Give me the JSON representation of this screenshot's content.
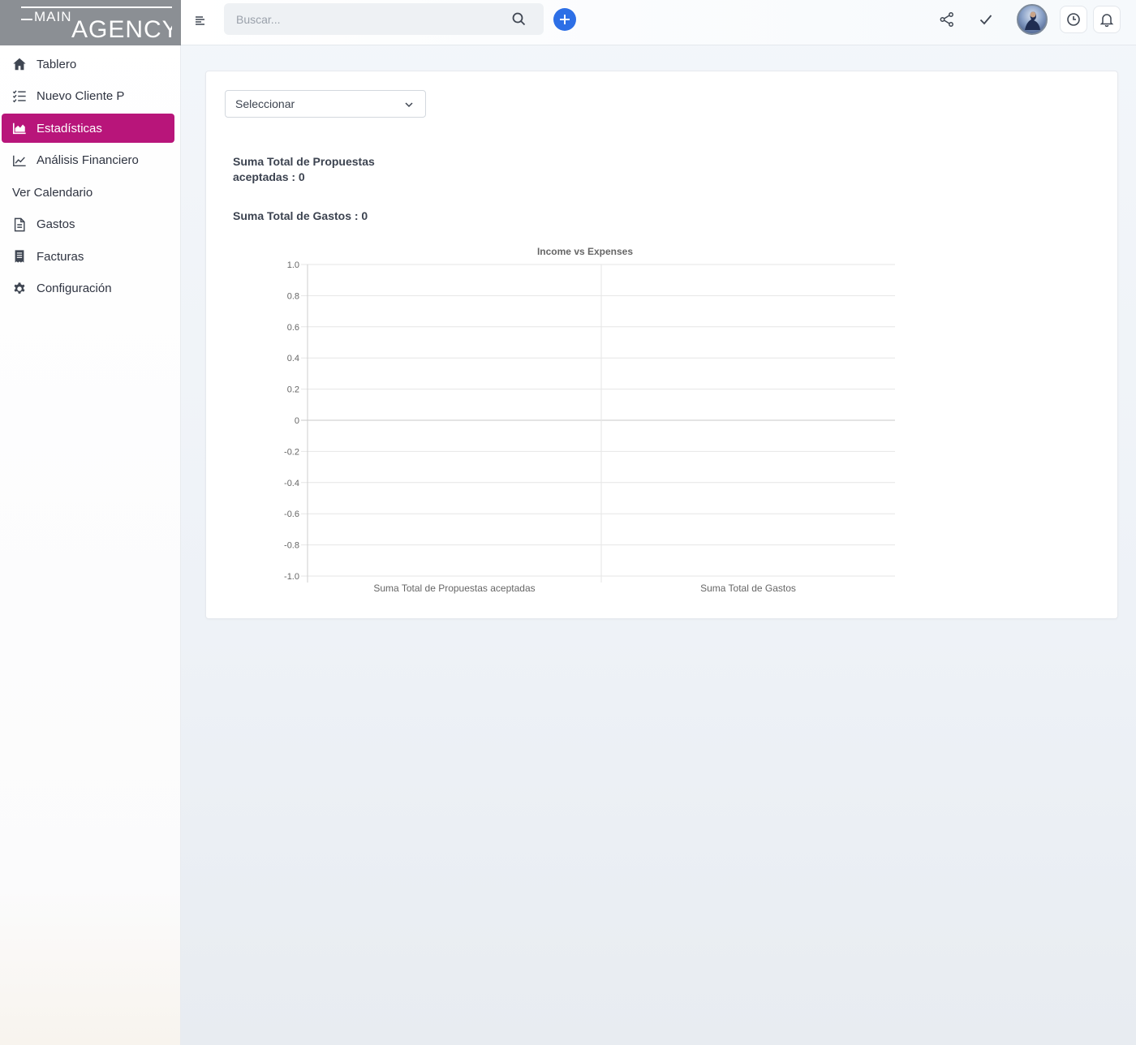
{
  "brand": {
    "logo_text": "MAIN AGENCY"
  },
  "sidebar": {
    "items": [
      {
        "label": "Tablero",
        "icon": "home-icon"
      },
      {
        "label": "Nuevo Cliente P",
        "icon": "checklist-icon"
      },
      {
        "label": "Estadísticas",
        "icon": "area-chart-icon",
        "active": true
      },
      {
        "label": "Análisis Financiero",
        "icon": "line-chart-icon"
      },
      {
        "label": "Ver Calendario"
      },
      {
        "label": "Gastos",
        "icon": "document-icon"
      },
      {
        "label": "Facturas",
        "icon": "receipt-icon"
      },
      {
        "label": "Configuración",
        "icon": "gear-icon"
      }
    ]
  },
  "header": {
    "search_placeholder": "Buscar...",
    "icons": [
      "menu-icon",
      "search-icon",
      "plus-icon",
      "share-icon",
      "check-icon",
      "avatar",
      "clock-icon",
      "bell-icon"
    ]
  },
  "main": {
    "select_label": "Seleccionar",
    "stat_proposals": "Suma Total de Propuestas aceptadas : 0",
    "stat_expenses": "Suma Total de Gastos : 0"
  },
  "colors": {
    "accent": "#b8157a",
    "primary": "#2d6fe6"
  },
  "chart_data": {
    "type": "bar",
    "title": "Income vs Expenses",
    "categories": [
      "Suma Total de Propuestas aceptadas",
      "Suma Total de Gastos"
    ],
    "values": [
      0,
      0
    ],
    "ylim": [
      -1.0,
      1.0
    ],
    "yticks": [
      "1.0",
      "0.8",
      "0.6",
      "0.4",
      "0.2",
      "0",
      "-0.2",
      "-0.4",
      "-0.6",
      "-0.8",
      "-1.0"
    ],
    "grid": true,
    "xlabel": "",
    "ylabel": ""
  }
}
